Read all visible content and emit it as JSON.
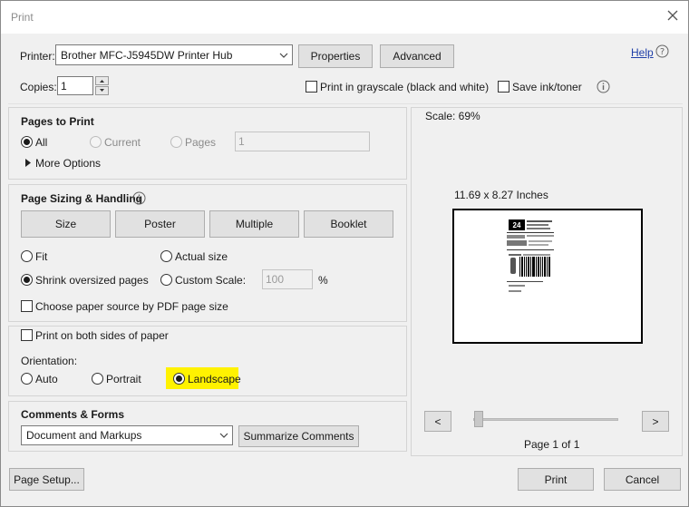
{
  "window": {
    "title": "Print"
  },
  "printer": {
    "label": "Printer:",
    "selected": "Brother MFC-J5945DW Printer Hub",
    "properties_label": "Properties",
    "advanced_label": "Advanced",
    "help_label": "Help"
  },
  "copies": {
    "label": "Copies:",
    "value": "1",
    "grayscale_label": "Print in grayscale (black and white)",
    "save_ink_label": "Save ink/toner"
  },
  "pages_to_print": {
    "heading": "Pages to Print",
    "all_label": "All",
    "current_label": "Current",
    "pages_label": "Pages",
    "pages_value": "1",
    "more_options_label": "More Options"
  },
  "sizing": {
    "heading": "Page Sizing & Handling",
    "tabs": [
      "Size",
      "Poster",
      "Multiple",
      "Booklet"
    ],
    "fit_label": "Fit",
    "actual_size_label": "Actual size",
    "shrink_label": "Shrink oversized pages",
    "custom_scale_label": "Custom Scale:",
    "custom_scale_value": "100",
    "percent_label": "%",
    "paper_source_label": "Choose paper source by PDF page size"
  },
  "duplex": {
    "both_sides_label": "Print on both sides of paper",
    "orientation_label": "Orientation:",
    "auto_label": "Auto",
    "portrait_label": "Portrait",
    "landscape_label": "Landscape",
    "highlight_color": "#fff200"
  },
  "comments": {
    "heading": "Comments & Forms",
    "selected": "Document and Markups",
    "summarize_label": "Summarize Comments"
  },
  "preview": {
    "scale_text": "Scale:  69%",
    "paper_size_text": "11.69 x 8.27 Inches",
    "label_number": "24",
    "prev_label": "<",
    "next_label": ">",
    "page_text": "Page 1 of 1"
  },
  "footer": {
    "page_setup_label": "Page Setup...",
    "print_label": "Print",
    "cancel_label": "Cancel"
  }
}
